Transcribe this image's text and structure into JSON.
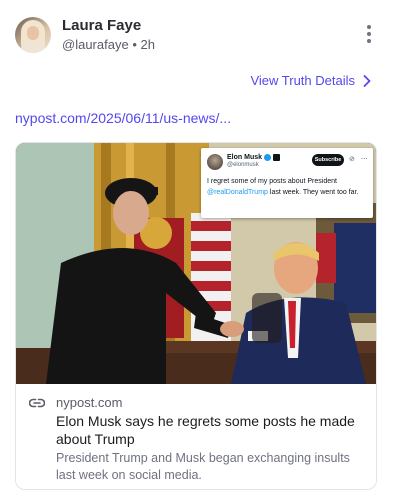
{
  "post": {
    "display_name": "Laura Faye",
    "handle": "@laurafaye",
    "separator": "•",
    "time_ago": "2h",
    "more_icon": "more-vertical-icon"
  },
  "truth_details": {
    "label": "View Truth Details",
    "icon": "chevron-right-icon"
  },
  "link_url": "nypost.com/2025/06/11/us-news/...",
  "link_card": {
    "link_icon": "link-icon",
    "site": "nypost.com",
    "title": "Elon Musk says he regrets some posts he made about Trump",
    "description": "President Trump and Musk began exchanging insults last week on social media.",
    "image": {
      "tweet": {
        "name": "Elon Musk",
        "handle": "@elonmusk",
        "subscribe_label": "Subscribe",
        "icons": "⊘ ⋯",
        "text_before": "I regret some of my posts about President ",
        "mention": "@realDonaldTrump",
        "text_after": " last week. They went too far."
      }
    }
  },
  "colors": {
    "accent": "#5448ee",
    "muted": "#5b5b66",
    "border": "#e3e4ea",
    "x_blue": "#1d9bf0"
  }
}
